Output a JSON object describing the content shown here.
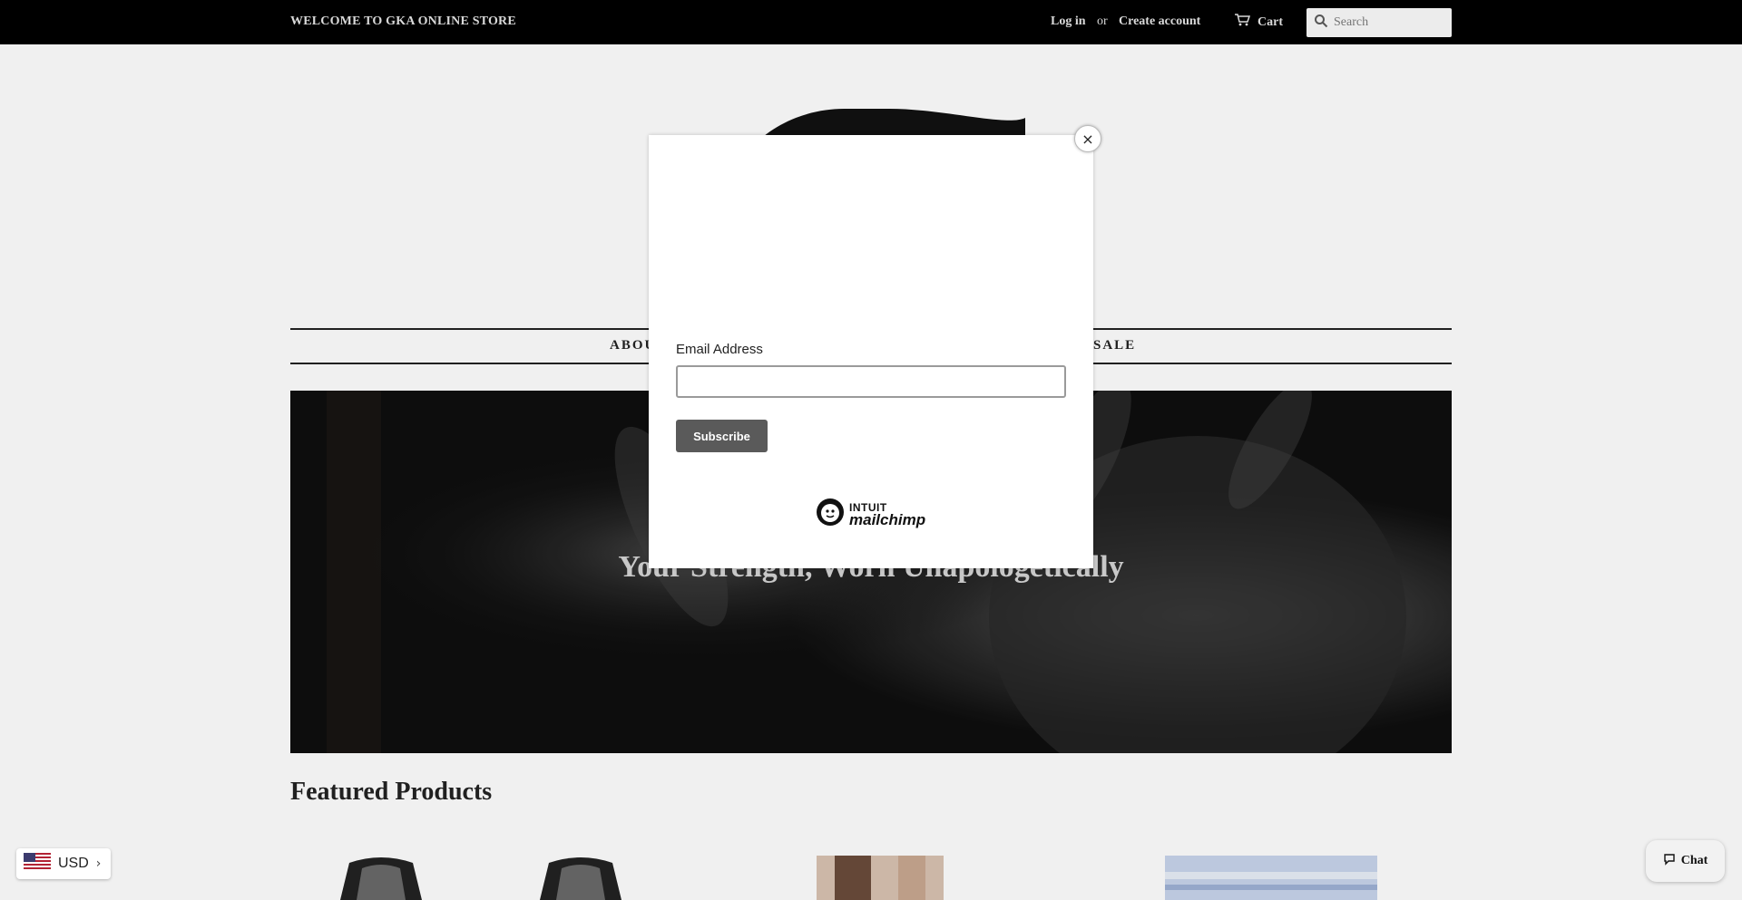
{
  "topbar": {
    "welcome": "WELCOME TO GKA ONLINE STORE",
    "login": "Log in",
    "or": "or",
    "create_account": "Create account",
    "cart": "Cart",
    "search_placeholder": "Search"
  },
  "nav": {
    "items": [
      "ABOU",
      "SALE"
    ]
  },
  "hero": {
    "title": "Your Strength, Worn Unapologetically"
  },
  "featured": {
    "title": "Featured Products"
  },
  "modal": {
    "email_label": "Email Address",
    "email_value": "",
    "subscribe": "Subscribe",
    "brand_top": "INTUIT",
    "brand_name": "mailchimp",
    "close": "×"
  },
  "currency": {
    "code": "USD"
  },
  "chat": {
    "label": "Chat"
  },
  "icons": {
    "cart": "cart-icon",
    "search": "search-icon",
    "close": "close-icon",
    "flag": "us-flag-icon",
    "chevron": "chevron-right-icon",
    "chat": "chat-bubble-icon"
  }
}
